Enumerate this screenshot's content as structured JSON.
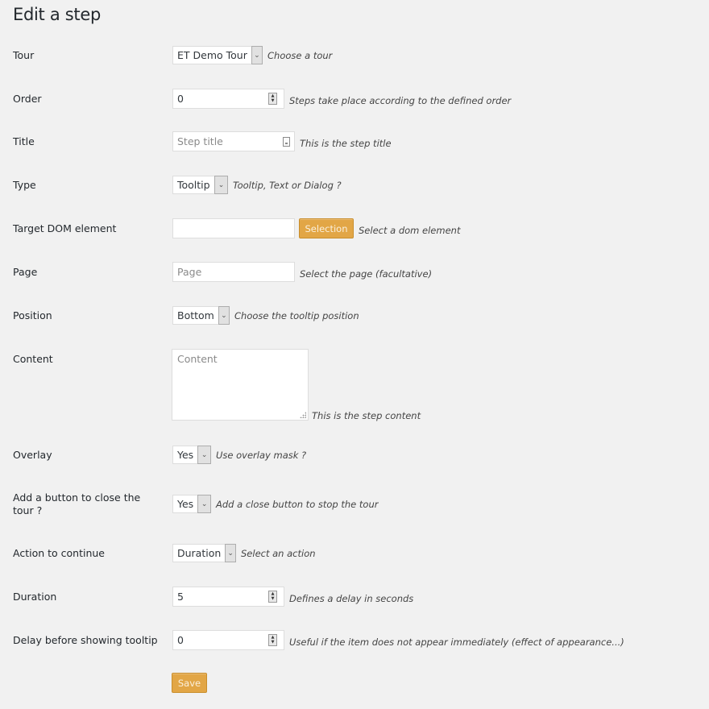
{
  "page": {
    "title": "Edit a step"
  },
  "fields": {
    "tour": {
      "label": "Tour",
      "value": "ET Demo Tour",
      "description": "Choose a tour"
    },
    "order": {
      "label": "Order",
      "value": "0",
      "description": "Steps take place according to the defined order"
    },
    "title": {
      "label": "Title",
      "placeholder": "Step title",
      "description": "This is the step title"
    },
    "type": {
      "label": "Type",
      "value": "Tooltip",
      "description": "Tooltip, Text or Dialog ?"
    },
    "target": {
      "label": "Target DOM element",
      "value": "",
      "button_label": "Selection",
      "description": "Select a dom element"
    },
    "page": {
      "label": "Page",
      "placeholder": "Page",
      "description": "Select the page (facultative)"
    },
    "position": {
      "label": "Position",
      "value": "Bottom",
      "description": "Choose the tooltip position"
    },
    "content": {
      "label": "Content",
      "placeholder": "Content",
      "description": "This is the step content"
    },
    "overlay": {
      "label": "Overlay",
      "value": "Yes",
      "description": "Use overlay mask ?"
    },
    "close_button": {
      "label": "Add a button to close the tour ?",
      "value": "Yes",
      "description": "Add a close button to stop the tour"
    },
    "action": {
      "label": "Action to continue",
      "value": "Duration",
      "description": "Select an action"
    },
    "duration": {
      "label": "Duration",
      "value": "5",
      "description": "Defines a delay in seconds"
    },
    "delay": {
      "label": "Delay before showing tooltip",
      "value": "0",
      "description": "Useful if the item does not appear immediately (effect of appearance...)"
    }
  },
  "actions": {
    "save_label": "Save"
  },
  "colors": {
    "accent": "#e2a646",
    "background": "#f1f1f1"
  }
}
